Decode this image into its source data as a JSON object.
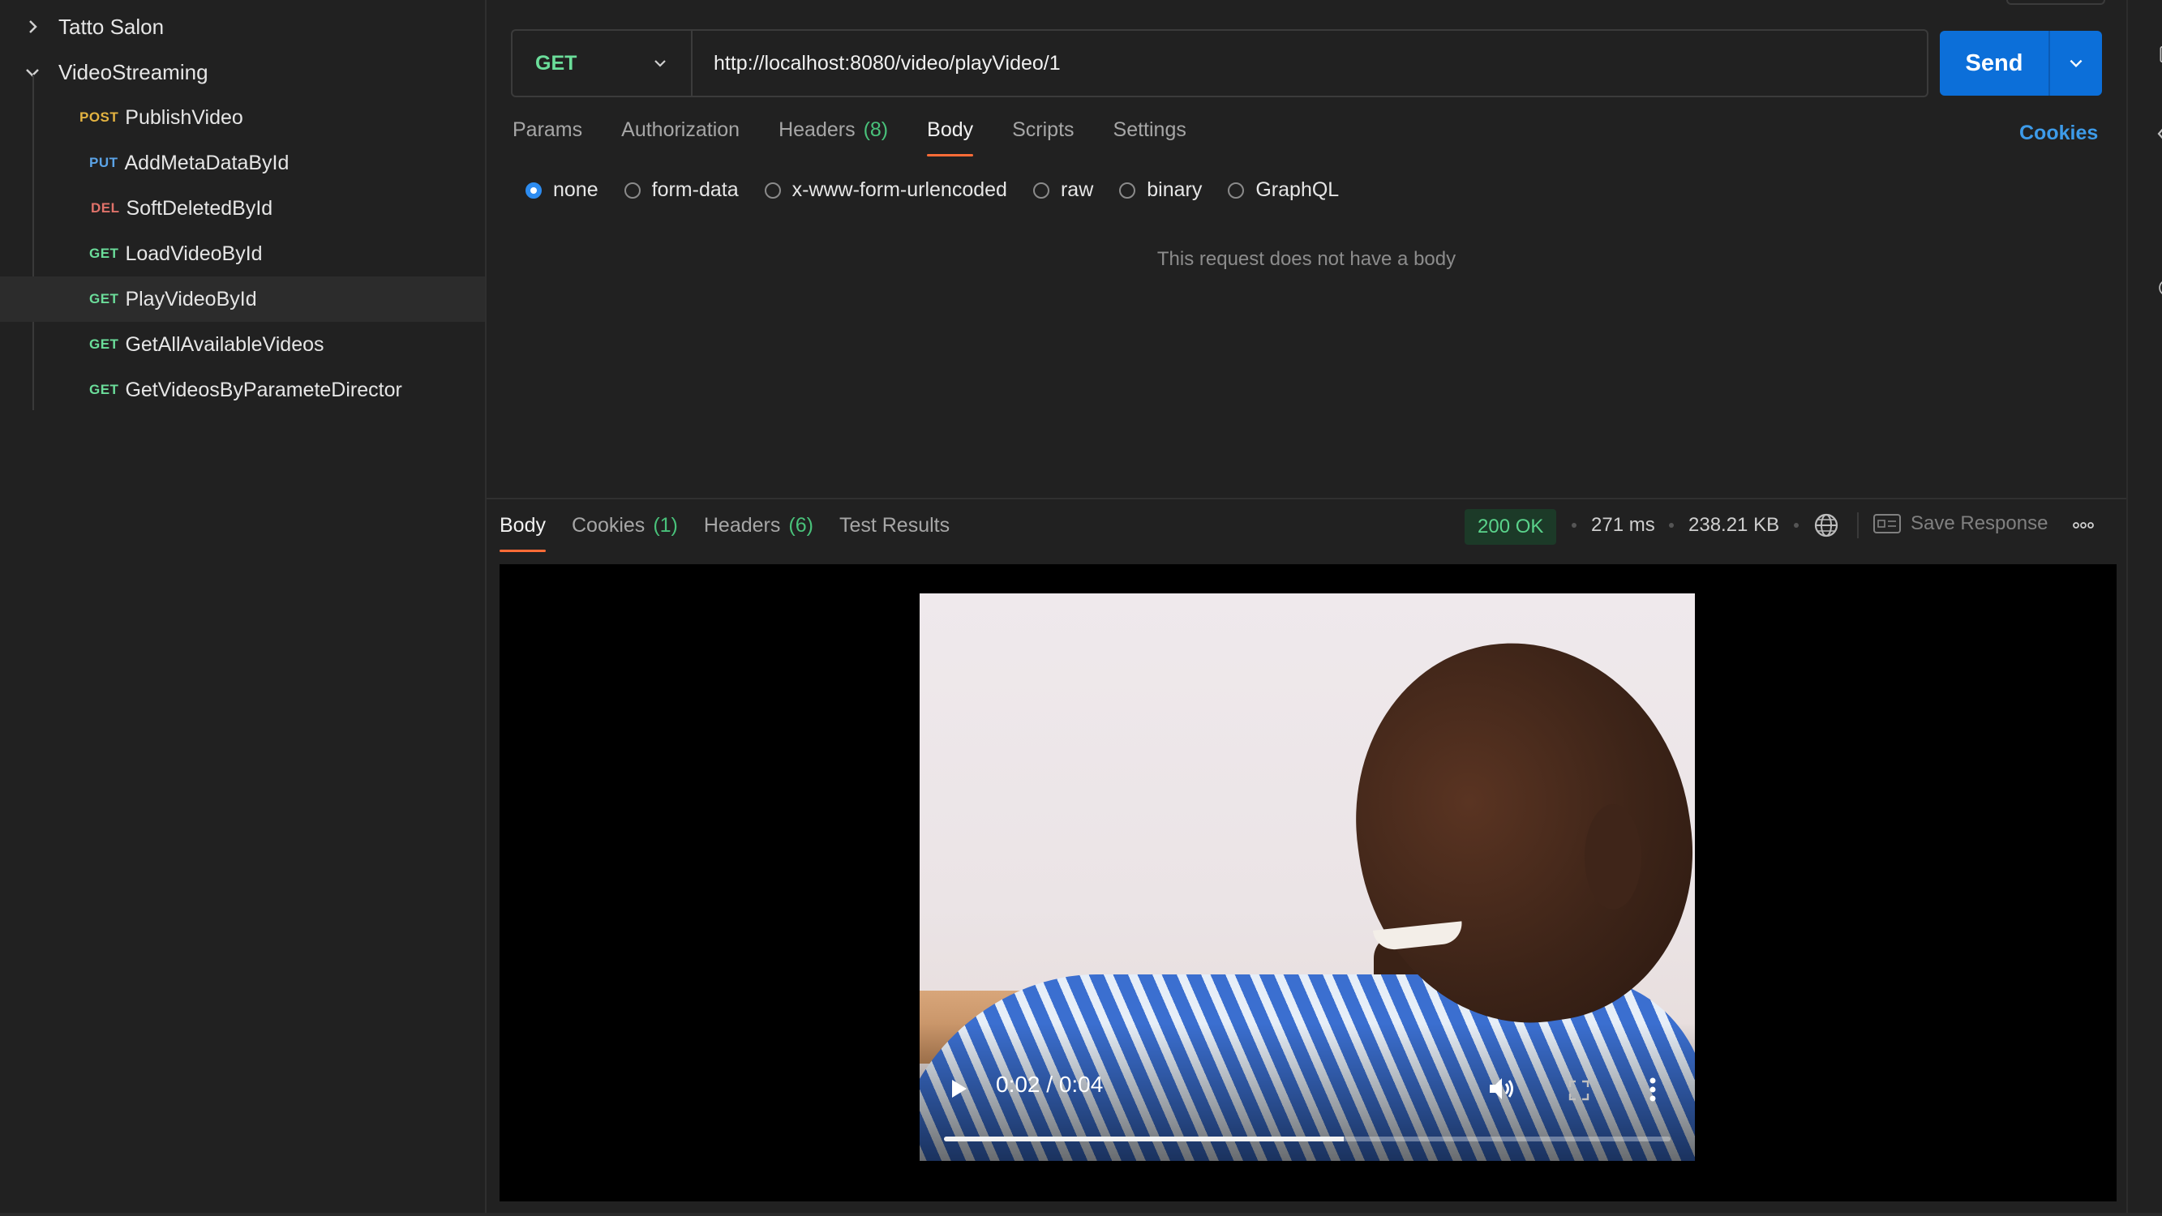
{
  "sidebar": {
    "folders": [
      {
        "label": "Tatto Salon",
        "expanded": false
      },
      {
        "label": "VideoStreaming",
        "expanded": true
      }
    ],
    "requests": [
      {
        "method": "POST",
        "name": "PublishVideo",
        "color": "#e3b341"
      },
      {
        "method": "PUT",
        "name": "AddMetaDataById",
        "color": "#5ba3e6"
      },
      {
        "method": "DEL",
        "name": "SoftDeletedById",
        "color": "#e0726a"
      },
      {
        "method": "GET",
        "name": "LoadVideoById",
        "color": "#6bdd9a"
      },
      {
        "method": "GET",
        "name": "PlayVideoById",
        "color": "#6bdd9a",
        "selected": true
      },
      {
        "method": "GET",
        "name": "GetAllAvailableVideos",
        "color": "#6bdd9a"
      },
      {
        "method": "GET",
        "name": "GetVideosByParameteDirector",
        "color": "#6bdd9a"
      }
    ]
  },
  "request": {
    "method": "GET",
    "url": "http://localhost:8080/video/playVideo/1",
    "send_label": "Send",
    "tabs": [
      {
        "label": "Params",
        "count": ""
      },
      {
        "label": "Authorization",
        "count": ""
      },
      {
        "label": "Headers",
        "count": "(8)"
      },
      {
        "label": "Body",
        "count": "",
        "active": true
      },
      {
        "label": "Scripts",
        "count": ""
      },
      {
        "label": "Settings",
        "count": ""
      }
    ],
    "cookies_label": "Cookies",
    "body_types": [
      "none",
      "form-data",
      "x-www-form-urlencoded",
      "raw",
      "binary",
      "GraphQL"
    ],
    "selected_body_type": "none",
    "no_body_text": "This request does not have a body"
  },
  "response": {
    "tabs": [
      {
        "label": "Body",
        "count": "",
        "active": true
      },
      {
        "label": "Cookies",
        "count": "(1)"
      },
      {
        "label": "Headers",
        "count": "(6)"
      },
      {
        "label": "Test Results",
        "count": ""
      }
    ],
    "status": "200 OK",
    "time": "271 ms",
    "size": "238.21 KB",
    "save_label": "Save Response",
    "video": {
      "time_display": "0:02 / 0:04",
      "progress_fraction": 0.55
    }
  },
  "colors": {
    "accent": "#ff6c37",
    "send": "#0c6fd9",
    "get": "#6bdd9a",
    "link": "#3d9be9"
  }
}
